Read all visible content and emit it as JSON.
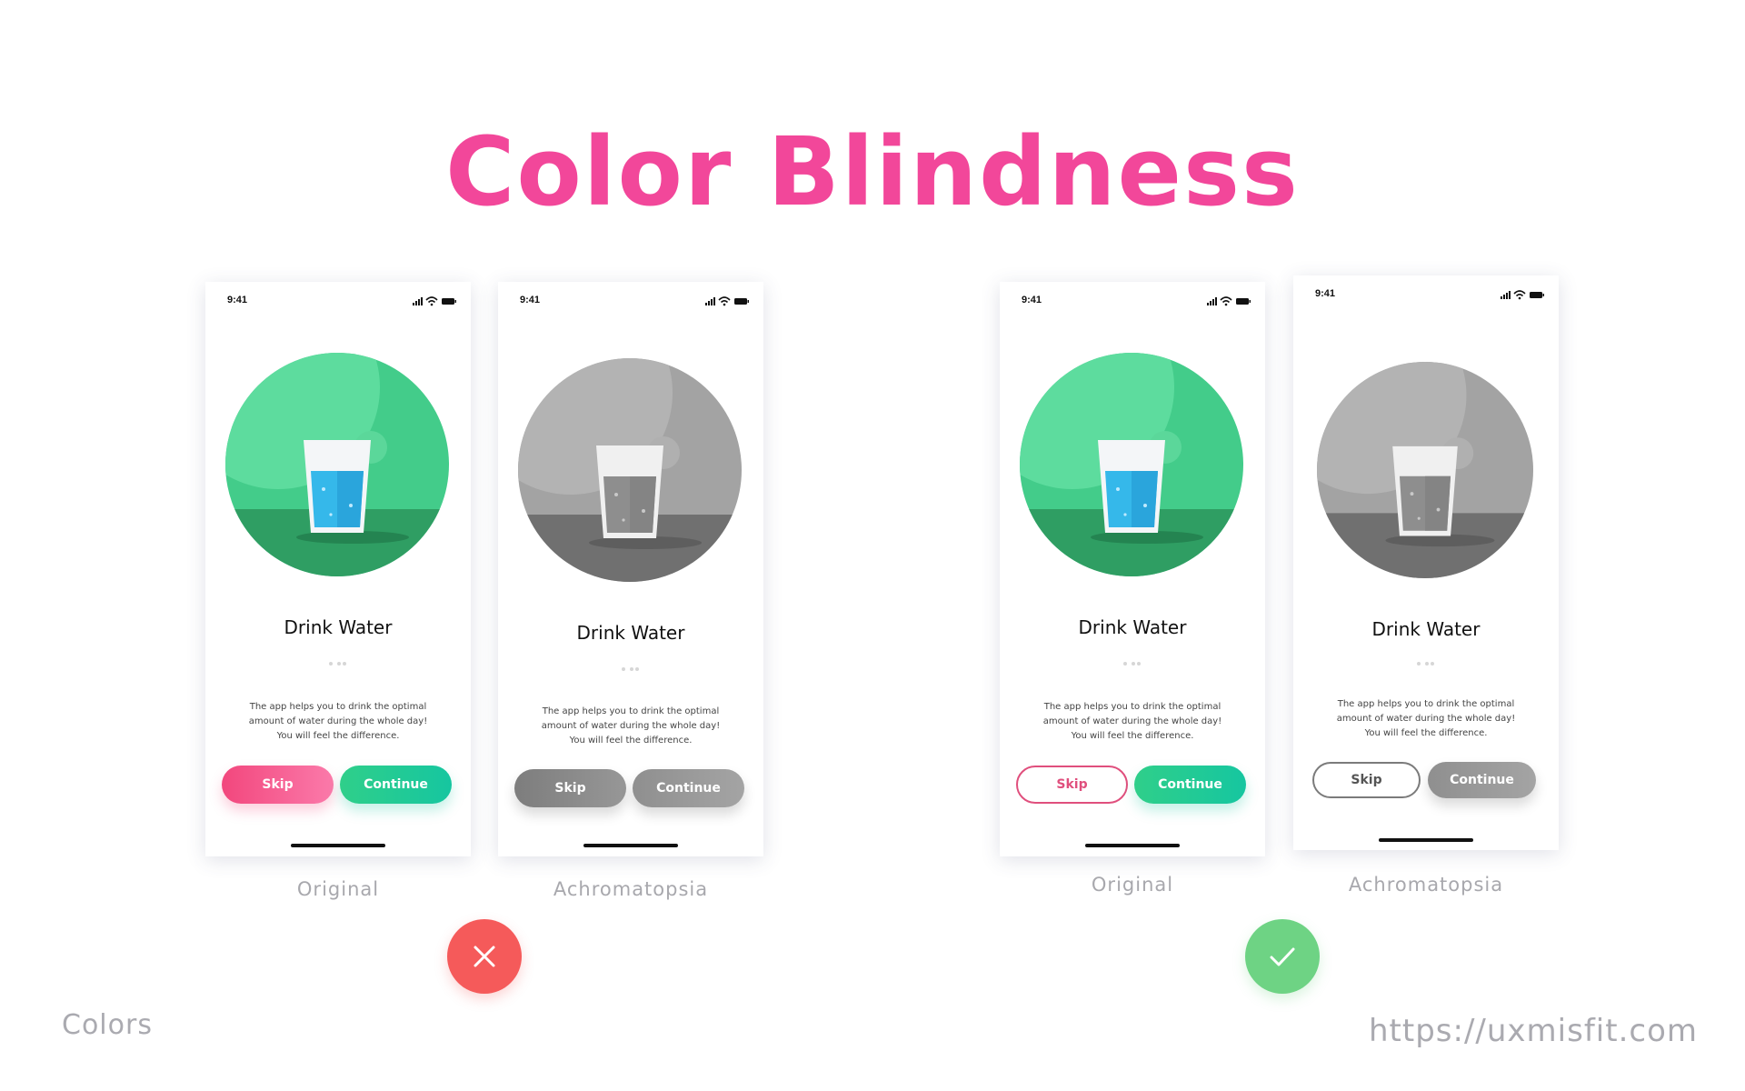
{
  "title": "Color Blindness",
  "phone": {
    "time": "9:41",
    "card_title": "Drink Water",
    "description": [
      "The app helps you to drink the optimal",
      "amount of water during the whole day!",
      "You will feel the difference."
    ],
    "skip_label": "Skip",
    "continue_label": "Continue"
  },
  "captions": {
    "original": "Original",
    "achromatopsia": "Achromatopsia"
  },
  "footer": {
    "left": "Colors",
    "right": "https://uxmisfit.com"
  },
  "colors": {
    "title": "#f2479a",
    "skip_pink": "#f2477d",
    "continue_green": "#16c6a0",
    "illustration_green": "#4fd394",
    "bad_badge": "#f55a5a",
    "good_badge": "#6ed384"
  },
  "icons": {
    "bad": "x-icon",
    "good": "check-icon"
  },
  "verdicts": {
    "left_group": "bad",
    "right_group": "good"
  }
}
